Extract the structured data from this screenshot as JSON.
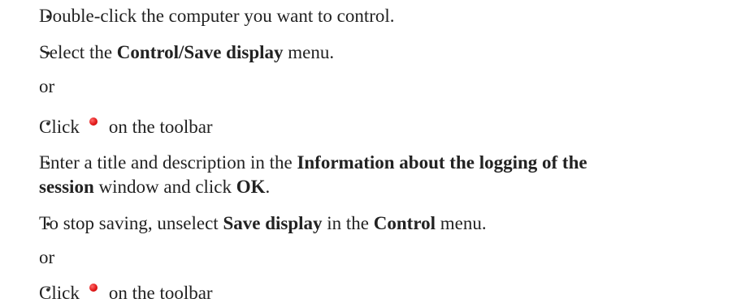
{
  "steps": [
    {
      "parts": [
        "Double-click the computer you want to control."
      ]
    },
    {
      "parts": [
        "Select the ",
        "Control/Save display",
        " menu."
      ]
    },
    {
      "text": "or"
    },
    {
      "before": "Click",
      "icon": "record-icon",
      "after": "on the toolbar"
    },
    {
      "parts": [
        "Enter a title and description in the ",
        "Information about the logging of the",
        ""
      ]
    },
    {
      "parts": [
        "session",
        " window and click ",
        "OK",
        "."
      ]
    },
    {
      "parts": [
        "To stop saving, unselect ",
        "Save display",
        " in the ",
        "Control",
        " menu."
      ]
    },
    {
      "text": "or"
    },
    {
      "before": "Click",
      "icon": "record-icon",
      "after": "on the toolbar"
    }
  ],
  "bullet_char": "•",
  "colors": {
    "text": "#222222",
    "record_icon": "#e21a1a"
  }
}
